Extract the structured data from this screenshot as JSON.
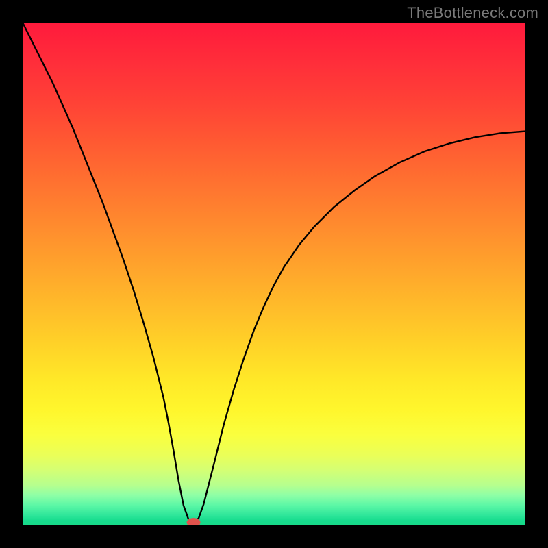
{
  "watermark": {
    "text": "TheBottleneck.com"
  },
  "chart_data": {
    "type": "line",
    "title": "",
    "xlabel": "",
    "ylabel": "",
    "xlim": [
      0,
      100
    ],
    "ylim": [
      0,
      100
    ],
    "grid": false,
    "legend": false,
    "background": "spectral-vertical-gradient",
    "series": [
      {
        "name": "bottleneck-curve",
        "color": "#000000",
        "x": [
          0,
          2,
          4,
          6,
          8,
          10,
          12,
          14,
          16,
          18,
          20,
          22,
          24,
          26,
          28,
          29,
          30,
          31,
          32,
          33,
          34,
          35,
          36,
          38,
          40,
          42,
          44,
          46,
          48,
          50,
          52,
          55,
          58,
          62,
          66,
          70,
          75,
          80,
          85,
          90,
          95,
          100
        ],
        "values": [
          100,
          96,
          92,
          88,
          83.5,
          79,
          74,
          69,
          64,
          58.5,
          53,
          47,
          40.5,
          33.5,
          25.5,
          20.5,
          15,
          9,
          4,
          1.2,
          0.6,
          1.4,
          4.2,
          12,
          20,
          27,
          33.2,
          38.8,
          43.6,
          47.8,
          51.4,
          55.8,
          59.4,
          63.4,
          66.6,
          69.4,
          72.2,
          74.4,
          76.0,
          77.2,
          78.0,
          78.4
        ]
      }
    ],
    "marker": {
      "name": "optimum-marker",
      "x": 34,
      "y": 0.6,
      "color": "#e0534d"
    }
  }
}
